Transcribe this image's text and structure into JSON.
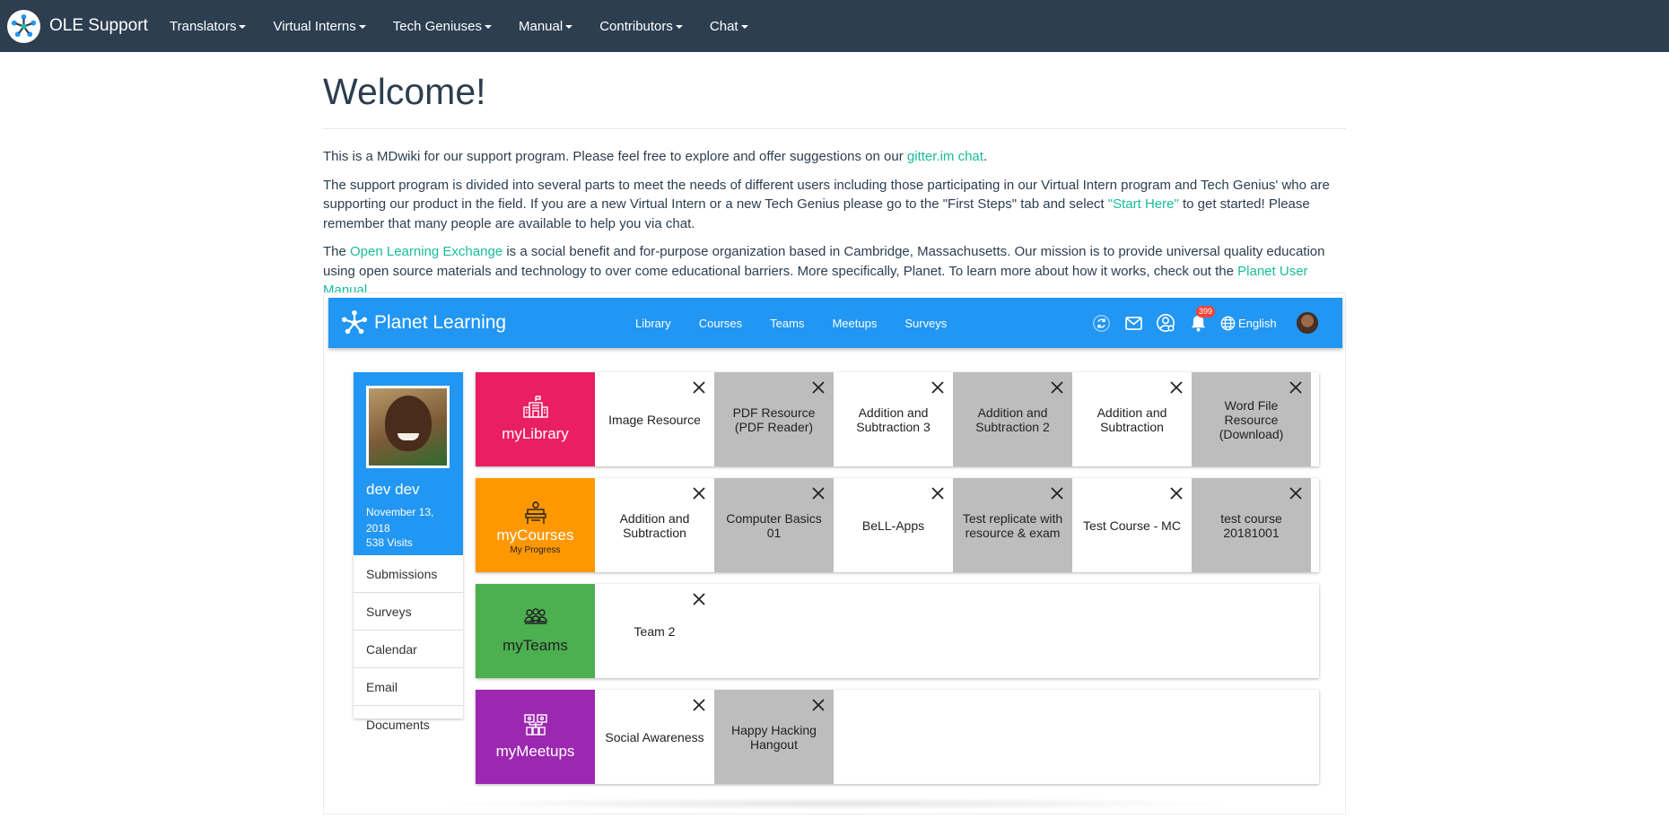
{
  "navbar": {
    "brand": "OLE Support",
    "items": [
      {
        "label": "Translators"
      },
      {
        "label": "Virtual Interns"
      },
      {
        "label": "Tech Geniuses"
      },
      {
        "label": "Manual"
      },
      {
        "label": "Contributors"
      },
      {
        "label": "Chat"
      }
    ]
  },
  "page": {
    "title": "Welcome!",
    "p1": {
      "before": "This is a MDwiki for our support program. Please feel free to explore and offer suggestions on our ",
      "link": "gitter.im chat",
      "after": "."
    },
    "p2": {
      "before": "The support program is divided into several parts to meet the needs of different users including those participating in our Virtual Intern program and Tech Genius' who are supporting our product in the field. If you are a new Virtual Intern or a new Tech Genius please go to the \"First Steps\" tab and select ",
      "link": "\"Start Here\"",
      "after": " to get started! Please remember that many people are available to help you via chat."
    },
    "p3": {
      "before": "The ",
      "link1": "Open Learning Exchange",
      "middle": " is a social benefit and for-purpose organization based in Cambridge, Massachusetts. Our mission is to provide universal quality education using open source materials and technology to over come educational barriers. More specifically, Planet. To learn more about how it works, check out the ",
      "link2": "Planet User Manual",
      "after": "."
    }
  },
  "planet": {
    "title": "Planet Learning",
    "nav": [
      "Library",
      "Courses",
      "Teams",
      "Meetups",
      "Surveys"
    ],
    "notifications_count": "399",
    "language": "English",
    "profile": {
      "name": "dev dev",
      "date": "November 13, 2018",
      "visits": "538 Visits",
      "menu": [
        "Submissions",
        "Surveys",
        "Calendar",
        "Email",
        "Documents"
      ]
    },
    "rows": {
      "library": {
        "label": "myLibrary",
        "color": "#e91e63",
        "tiles": [
          "Image Resource",
          "PDF Resource (PDF Reader)",
          "Addition and Subtraction 3",
          "Addition and Subtraction 2",
          "Addition and Subtraction",
          "Word File Resource (Download)"
        ]
      },
      "courses": {
        "label": "myCourses",
        "sublabel": "My Progress",
        "color": "#ff9800",
        "tiles": [
          "Addition and Subtraction",
          "Computer Basics 01",
          "BeLL-Apps",
          "Test replicate with resource & exam",
          "Test Course - MC",
          "test course 20181001"
        ]
      },
      "teams": {
        "label": "myTeams",
        "color": "#4caf50",
        "tiles": [
          "Team 2"
        ]
      },
      "meetups": {
        "label": "myMeetups",
        "color": "#9c27b0",
        "tiles": [
          "Social Awareness",
          "Happy Hacking Hangout"
        ]
      }
    },
    "colors": {
      "toolbar": "#2196f3",
      "tile_grey": "#bdbdbd"
    }
  },
  "colors": {
    "navbar": "#2c3e50",
    "link": "#18bc9c",
    "text": "#2c3e50"
  }
}
